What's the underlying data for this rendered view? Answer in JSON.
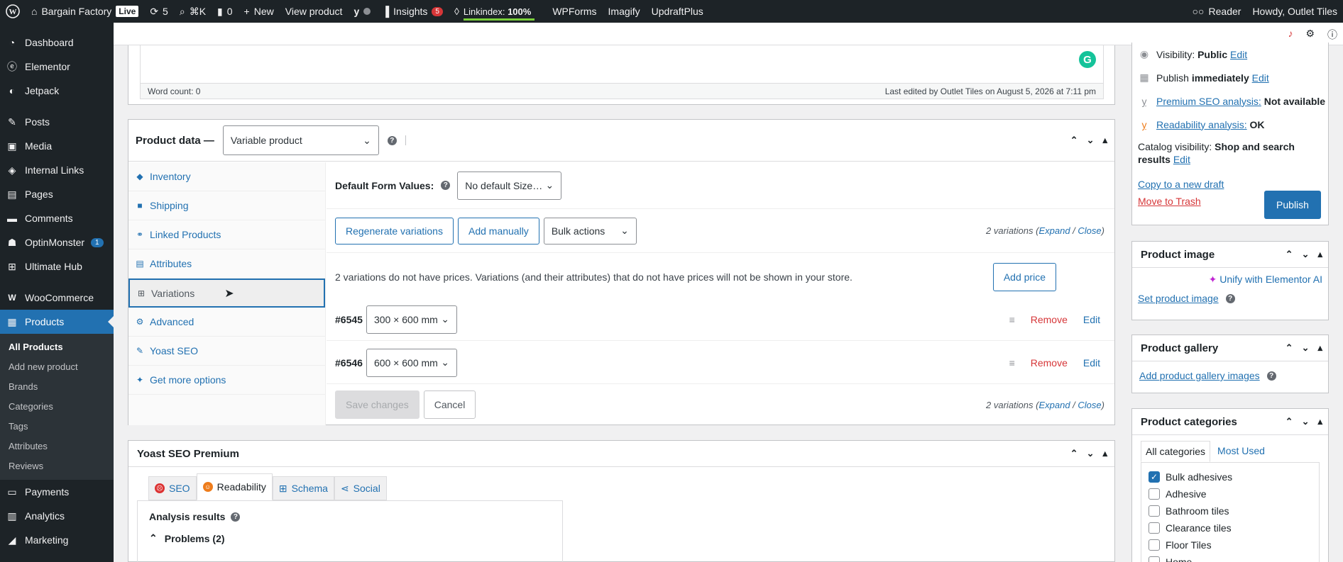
{
  "adminbar": {
    "site_name": "Bargain Factory",
    "live_label": "Live",
    "updates_count": "5",
    "command_shortcut": "⌘K",
    "comments_count": "0",
    "new_label": "New",
    "view_product": "View product",
    "insights_label": "Insights",
    "insights_count": "5",
    "linkindex_label": "Linkindex:",
    "linkindex_value": "100%",
    "wpforms": "WPForms",
    "imagify": "Imagify",
    "updraftplus": "UpdraftPlus",
    "reader": "Reader",
    "howdy": "Howdy, Outlet Tiles"
  },
  "sidebar": {
    "items_top": [
      {
        "label": "Dashboard",
        "icon": "dashboard-icon"
      },
      {
        "label": "Elementor",
        "icon": "elementor-icon"
      },
      {
        "label": "Jetpack",
        "icon": "jetpack-icon"
      }
    ],
    "items_mid": [
      {
        "label": "Posts",
        "icon": "pin-icon"
      },
      {
        "label": "Media",
        "icon": "media-icon"
      },
      {
        "label": "Internal Links",
        "icon": "link-icon"
      },
      {
        "label": "Pages",
        "icon": "pages-icon"
      },
      {
        "label": "Comments",
        "icon": "comment-icon"
      },
      {
        "label": "OptinMonster",
        "icon": "optinmonster-icon",
        "badge": "1"
      },
      {
        "label": "Ultimate Hub",
        "icon": "hub-icon"
      }
    ],
    "woocommerce": "WooCommerce",
    "products": "Products",
    "submenu": [
      "All Products",
      "Add new product",
      "Brands",
      "Categories",
      "Tags",
      "Attributes",
      "Reviews"
    ],
    "items_bottom": [
      {
        "label": "Payments",
        "icon": "payments-icon"
      },
      {
        "label": "Analytics",
        "icon": "analytics-icon"
      },
      {
        "label": "Marketing",
        "icon": "marketing-icon"
      }
    ]
  },
  "editor": {
    "word_count": "Word count: 0",
    "last_edited": "Last edited by Outlet Tiles on August 5, 2026 at 7:11 pm"
  },
  "product_data": {
    "title": "Product data —",
    "type_value": "Variable product",
    "tabs": [
      {
        "label": "Inventory",
        "icon": "tag-icon"
      },
      {
        "label": "Shipping",
        "icon": "truck-icon"
      },
      {
        "label": "Linked Products",
        "icon": "link-icon"
      },
      {
        "label": "Attributes",
        "icon": "list-icon"
      },
      {
        "label": "Variations",
        "icon": "grid-icon"
      },
      {
        "label": "Advanced",
        "icon": "gear-icon"
      },
      {
        "label": "Yoast SEO",
        "icon": "yoast-icon"
      },
      {
        "label": "Get more options",
        "icon": "plugin-icon"
      }
    ],
    "default_form_label": "Default Form Values:",
    "default_form_value": "No default Size…",
    "regenerate": "Regenerate variations",
    "add_manually": "Add manually",
    "bulk_actions": "Bulk actions",
    "variations_count": "2 variations",
    "expand": "Expand",
    "close": "Close",
    "notice": "2 variations do not have prices. Variations (and their attributes) that do not have prices will not be shown in your store.",
    "add_price": "Add price",
    "variations": [
      {
        "id": "#6545",
        "size": "300 × 600 mm"
      },
      {
        "id": "#6546",
        "size": "600 × 600 mm"
      }
    ],
    "remove": "Remove",
    "edit": "Edit",
    "save": "Save changes",
    "cancel": "Cancel"
  },
  "yoast": {
    "title": "Yoast SEO Premium",
    "tabs": [
      "SEO",
      "Readability",
      "Schema",
      "Social"
    ],
    "analysis_results": "Analysis results",
    "problems": "Problems (2)"
  },
  "publish": {
    "visibility_label": "Visibility:",
    "visibility_value": "Public",
    "publish_label": "Publish",
    "publish_value": "immediately",
    "edit": "Edit",
    "premium_seo": "Premium SEO analysis:",
    "premium_seo_value": "Not available",
    "readability": "Readability analysis:",
    "readability_value": "OK",
    "catalog_label": "Catalog visibility:",
    "catalog_value": "Shop and search results",
    "copy_draft": "Copy to a new draft",
    "trash": "Move to Trash",
    "publish_button": "Publish"
  },
  "product_image": {
    "title": "Product image",
    "unify": "Unify with Elementor AI",
    "set_image": "Set product image"
  },
  "product_gallery": {
    "title": "Product gallery",
    "add": "Add product gallery images"
  },
  "product_categories": {
    "title": "Product categories",
    "tab_all": "All categories",
    "tab_most": "Most Used",
    "items": [
      {
        "label": "Bulk adhesives",
        "checked": true
      },
      {
        "label": "Adhesive",
        "checked": false
      },
      {
        "label": "Bathroom tiles",
        "checked": false
      },
      {
        "label": "Clearance tiles",
        "checked": false
      },
      {
        "label": "Floor Tiles",
        "checked": false
      },
      {
        "label": "Home",
        "checked": false
      }
    ]
  },
  "colors": {
    "admin_dark": "#1d2327",
    "accent": "#2271b1",
    "danger": "#d63638"
  }
}
